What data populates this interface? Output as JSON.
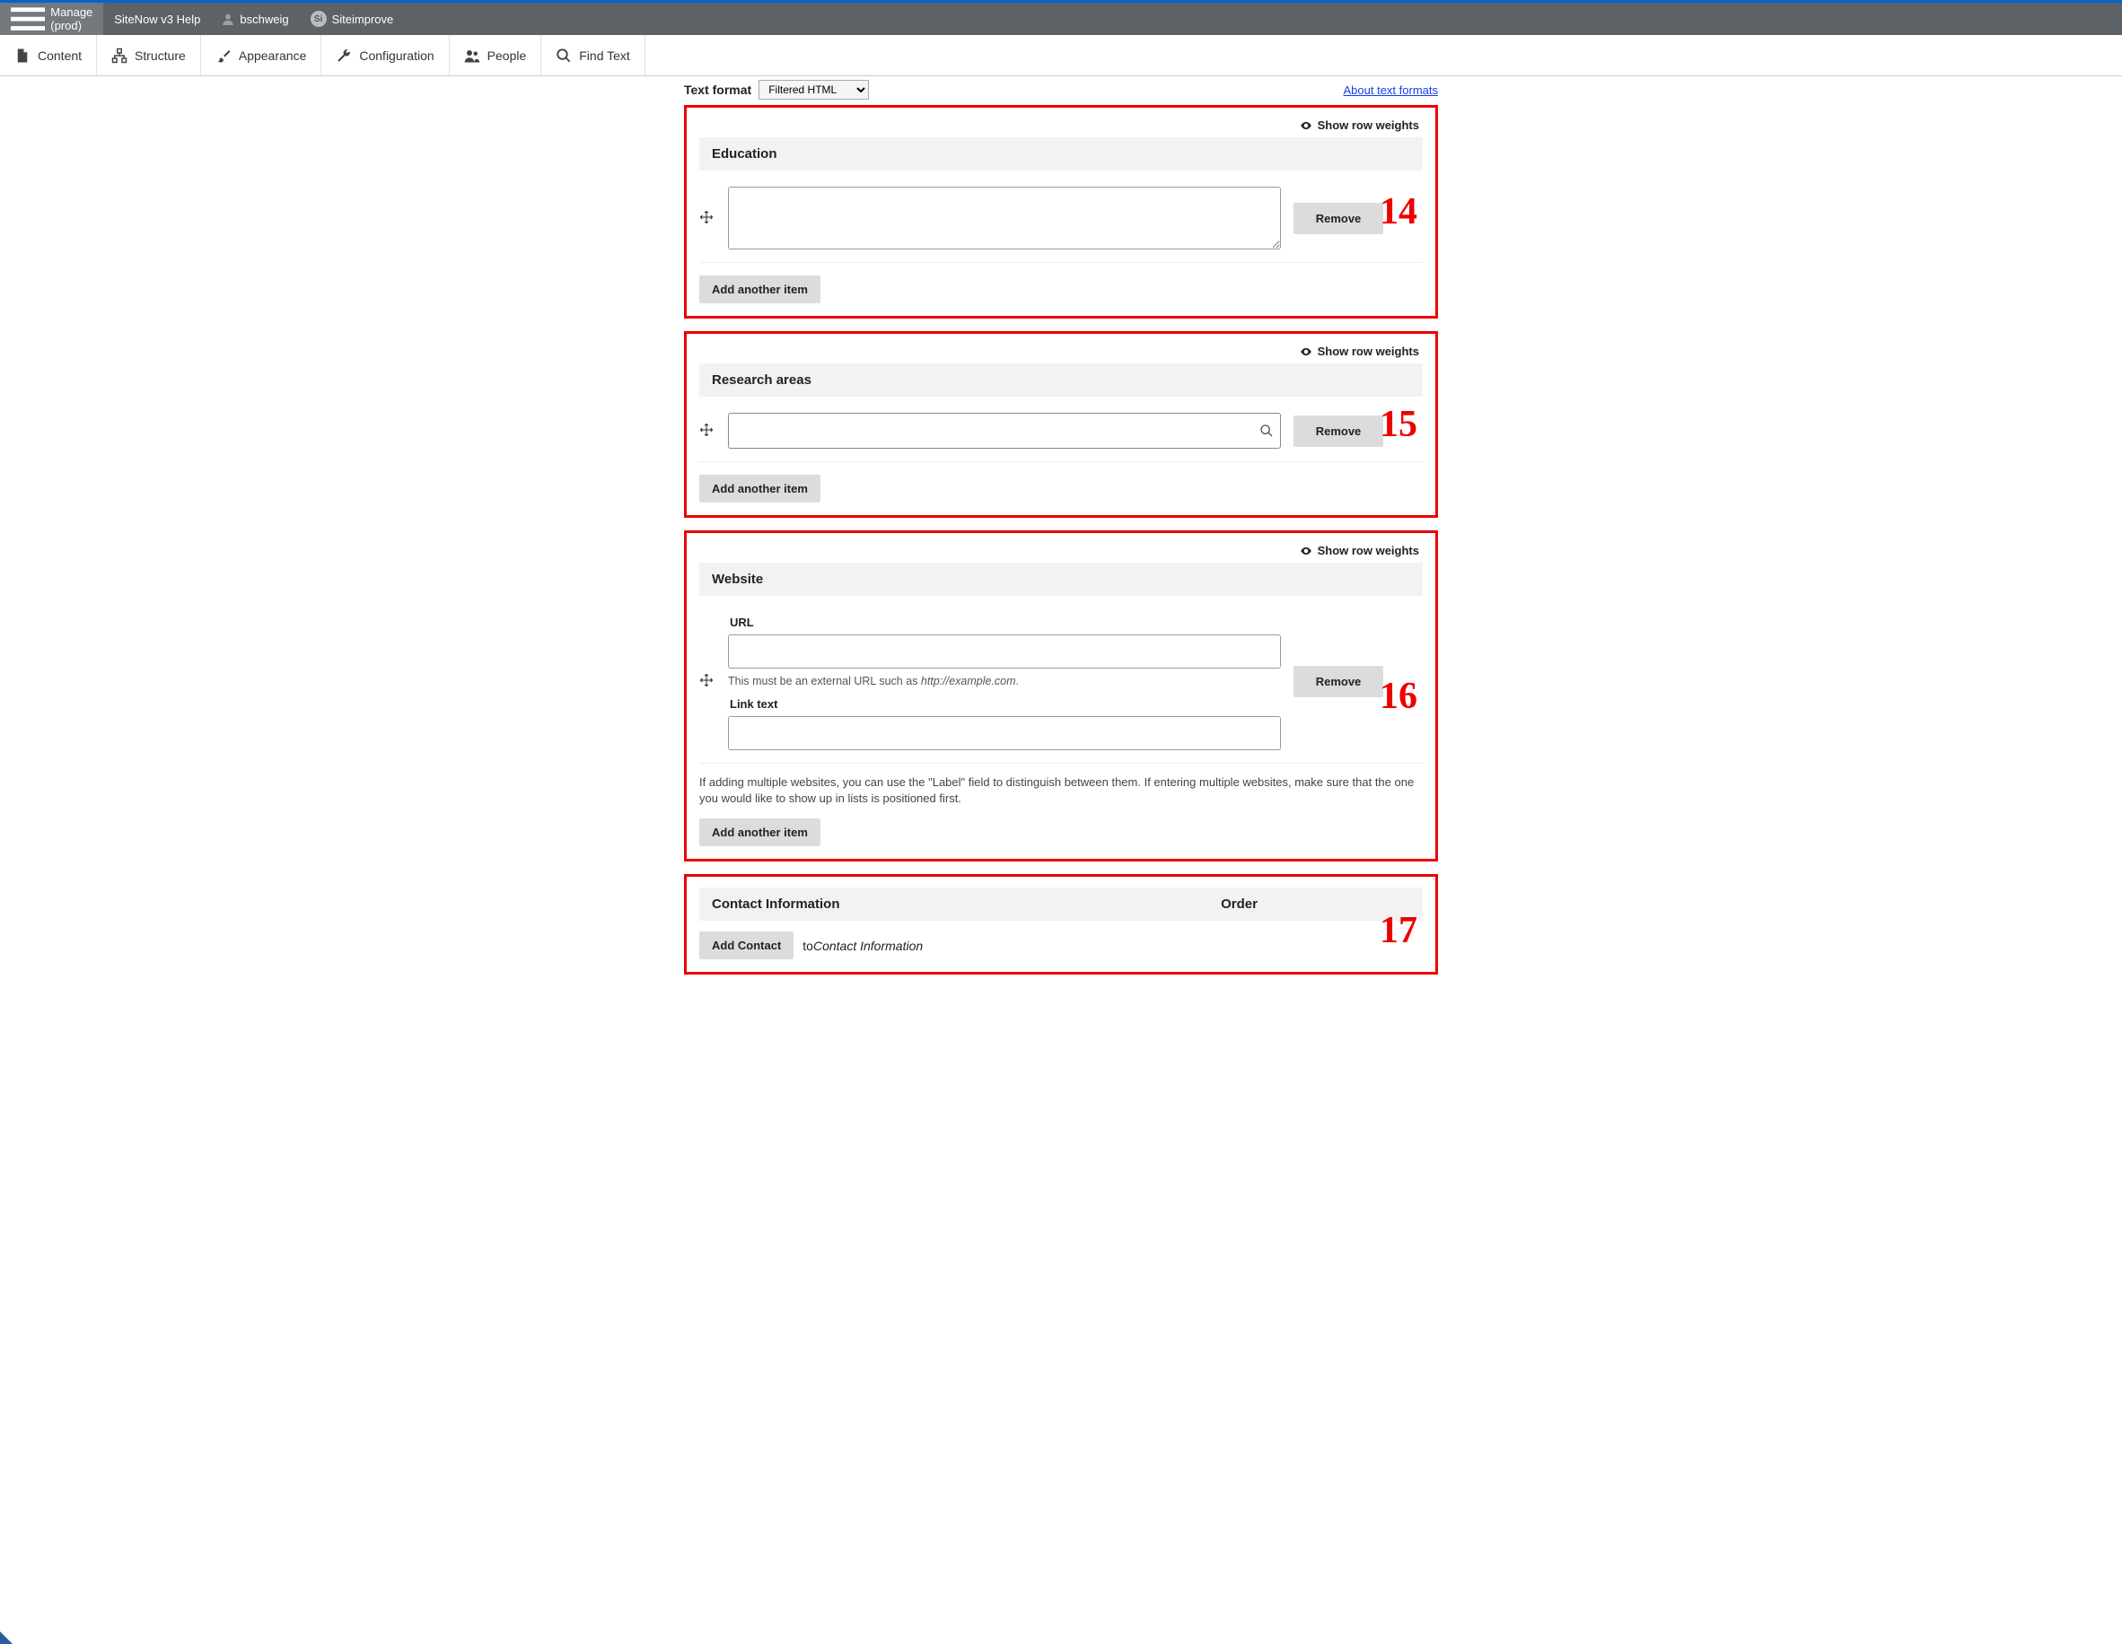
{
  "topbar2": {
    "manage": "Manage (prod)",
    "sitenowHelp": "SiteNow v3 Help",
    "username": "bschweig",
    "siBadge": "Si",
    "siteimprove": "Siteimprove"
  },
  "topbar3": {
    "content": "Content",
    "structure": "Structure",
    "appearance": "Appearance",
    "configuration": "Configuration",
    "people": "People",
    "findText": "Find Text"
  },
  "partialTop": {
    "textFormatLabel": "Text format",
    "textFormatValue": "Filtered HTML",
    "aboutLink": "About text formats"
  },
  "common": {
    "showRowWeights": "Show row weights",
    "removeBtn": "Remove",
    "addAnotherItem": "Add another item"
  },
  "sections": {
    "education": {
      "header": "Education",
      "num": "14"
    },
    "research": {
      "header": "Research areas",
      "num": "15"
    },
    "website": {
      "header": "Website",
      "num": "16",
      "urlLabel": "URL",
      "urlHelpPrefix": "This must be an external URL such as ",
      "urlHelpExample": "http://example.com",
      "urlHelpSuffix": ".",
      "linkTextLabel": "Link text",
      "blockHelp": "If adding multiple websites, you can use the \"Label\" field to distinguish between them. If entering multiple websites, make sure that the one you would like to show up in lists is positioned first."
    },
    "contact": {
      "header": "Contact Information",
      "orderHeader": "Order",
      "num": "17",
      "addContactBtn": "Add Contact",
      "addContactTextPrefix": "to",
      "addContactTextItalic": "Contact Information"
    }
  }
}
